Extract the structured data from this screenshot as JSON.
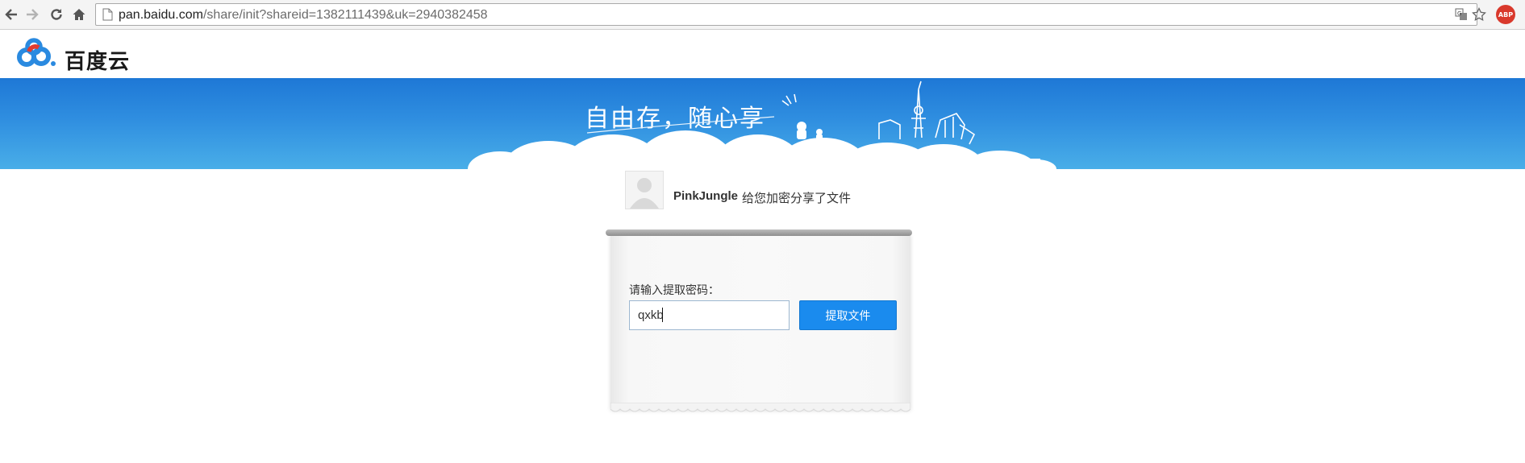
{
  "browser": {
    "url_host": "pan.baidu.com",
    "url_rest": "/share/init?shareid=1382111439&uk=2940382458",
    "abp_label": "ABP"
  },
  "site": {
    "logo_text": "百度云"
  },
  "banner": {
    "slogan": "自由存，随心享"
  },
  "share": {
    "sharer_name": "PinkJungle",
    "share_message": "给您加密分享了文件"
  },
  "form": {
    "password_label": "请输入提取密码：",
    "password_value": "qxkb",
    "submit_label": "提取文件"
  },
  "colors": {
    "banner_top": "#1e78d6",
    "banner_bottom": "#49aee8",
    "button": "#1a8bee",
    "abp": "#d9392c"
  }
}
